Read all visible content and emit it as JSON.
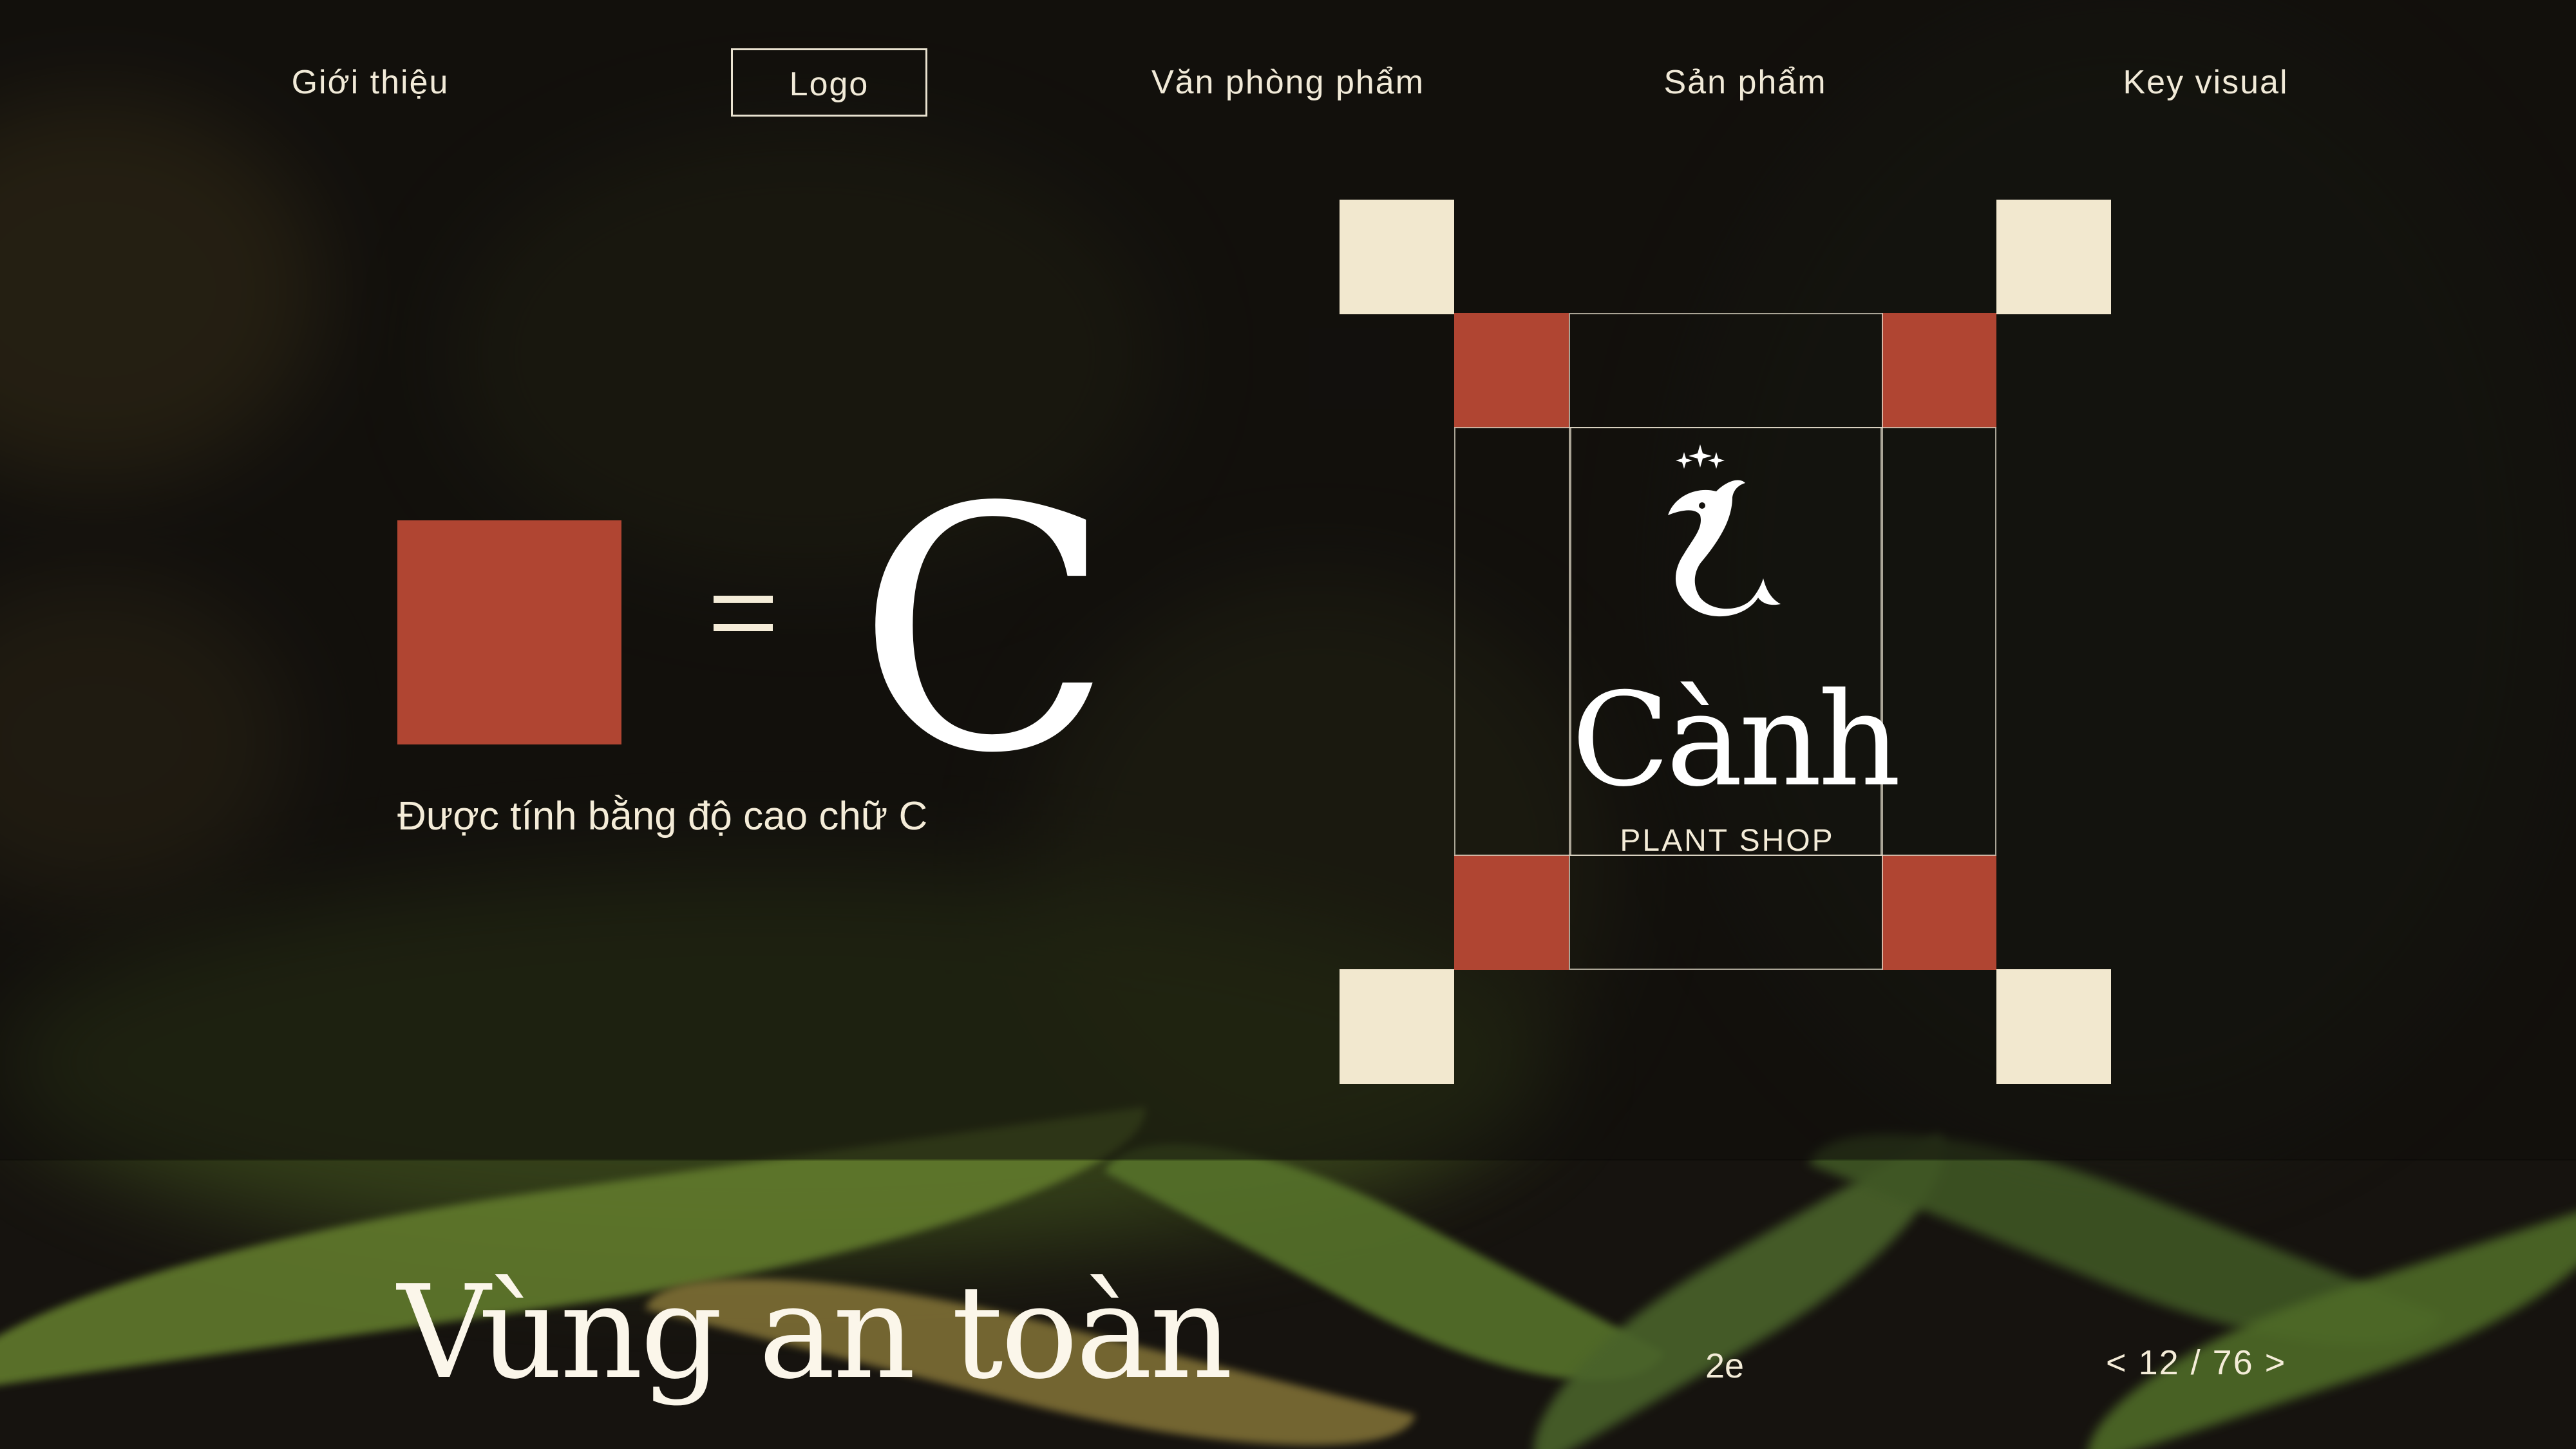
{
  "nav": {
    "items": [
      {
        "label": "Giới thiệu",
        "active": false
      },
      {
        "label": "Logo",
        "active": true
      },
      {
        "label": "Văn phòng phẩm",
        "active": false
      },
      {
        "label": "Sản phẩm",
        "active": false
      },
      {
        "label": "Key visual",
        "active": false
      }
    ]
  },
  "explanation": {
    "equals": "=",
    "letter": "C",
    "caption": "Được tính bằng độ cao chữ C"
  },
  "logo": {
    "wordmark": "Cành",
    "tagline": "PLANT SHOP",
    "icons": [
      "sparkle-icon",
      "bird-icon"
    ]
  },
  "footer": {
    "title": "Vùng an toàn",
    "code": "2e",
    "pager": {
      "prev": "<",
      "text": "12 / 76",
      "next": ">"
    }
  },
  "colors": {
    "accent_red": "#b04532",
    "cream": "#f2e8cf",
    "background": "#16130f"
  }
}
